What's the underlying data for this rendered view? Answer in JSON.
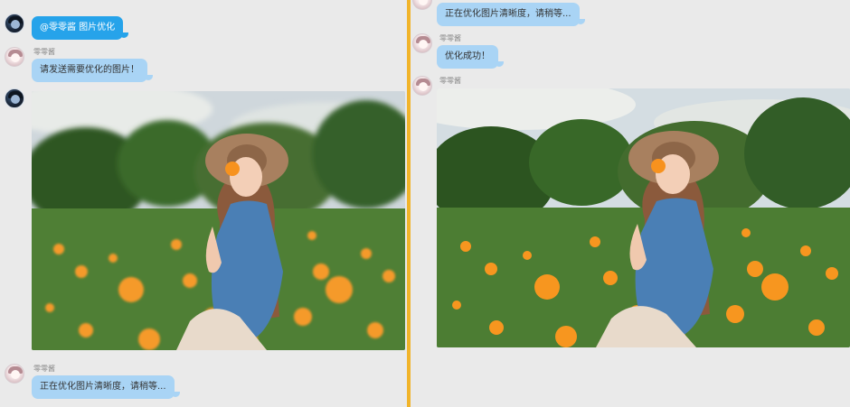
{
  "left_pane": {
    "mention_message": {
      "text": "@零零酱 图片优化"
    },
    "bot_reply": {
      "sender": "零零酱",
      "text": "请发送需要优化的图片！"
    },
    "bot_processing": {
      "sender": "零零酱",
      "text": "正在优化图片清晰度，请稍等..."
    }
  },
  "right_pane": {
    "bot_processing": {
      "text": "正在优化图片清晰度，请稍等..."
    },
    "bot_success": {
      "sender": "零零酱",
      "text": "优化成功！"
    },
    "bot_result": {
      "sender": "零零酱"
    }
  },
  "colors": {
    "divider": "#f1b42a",
    "bubble_blue": "#26a3ea",
    "bubble_light": "#a9d4f5"
  },
  "icons": {
    "user_avatar": "user-avatar-icon",
    "bot_avatar": "bot-avatar-icon"
  }
}
